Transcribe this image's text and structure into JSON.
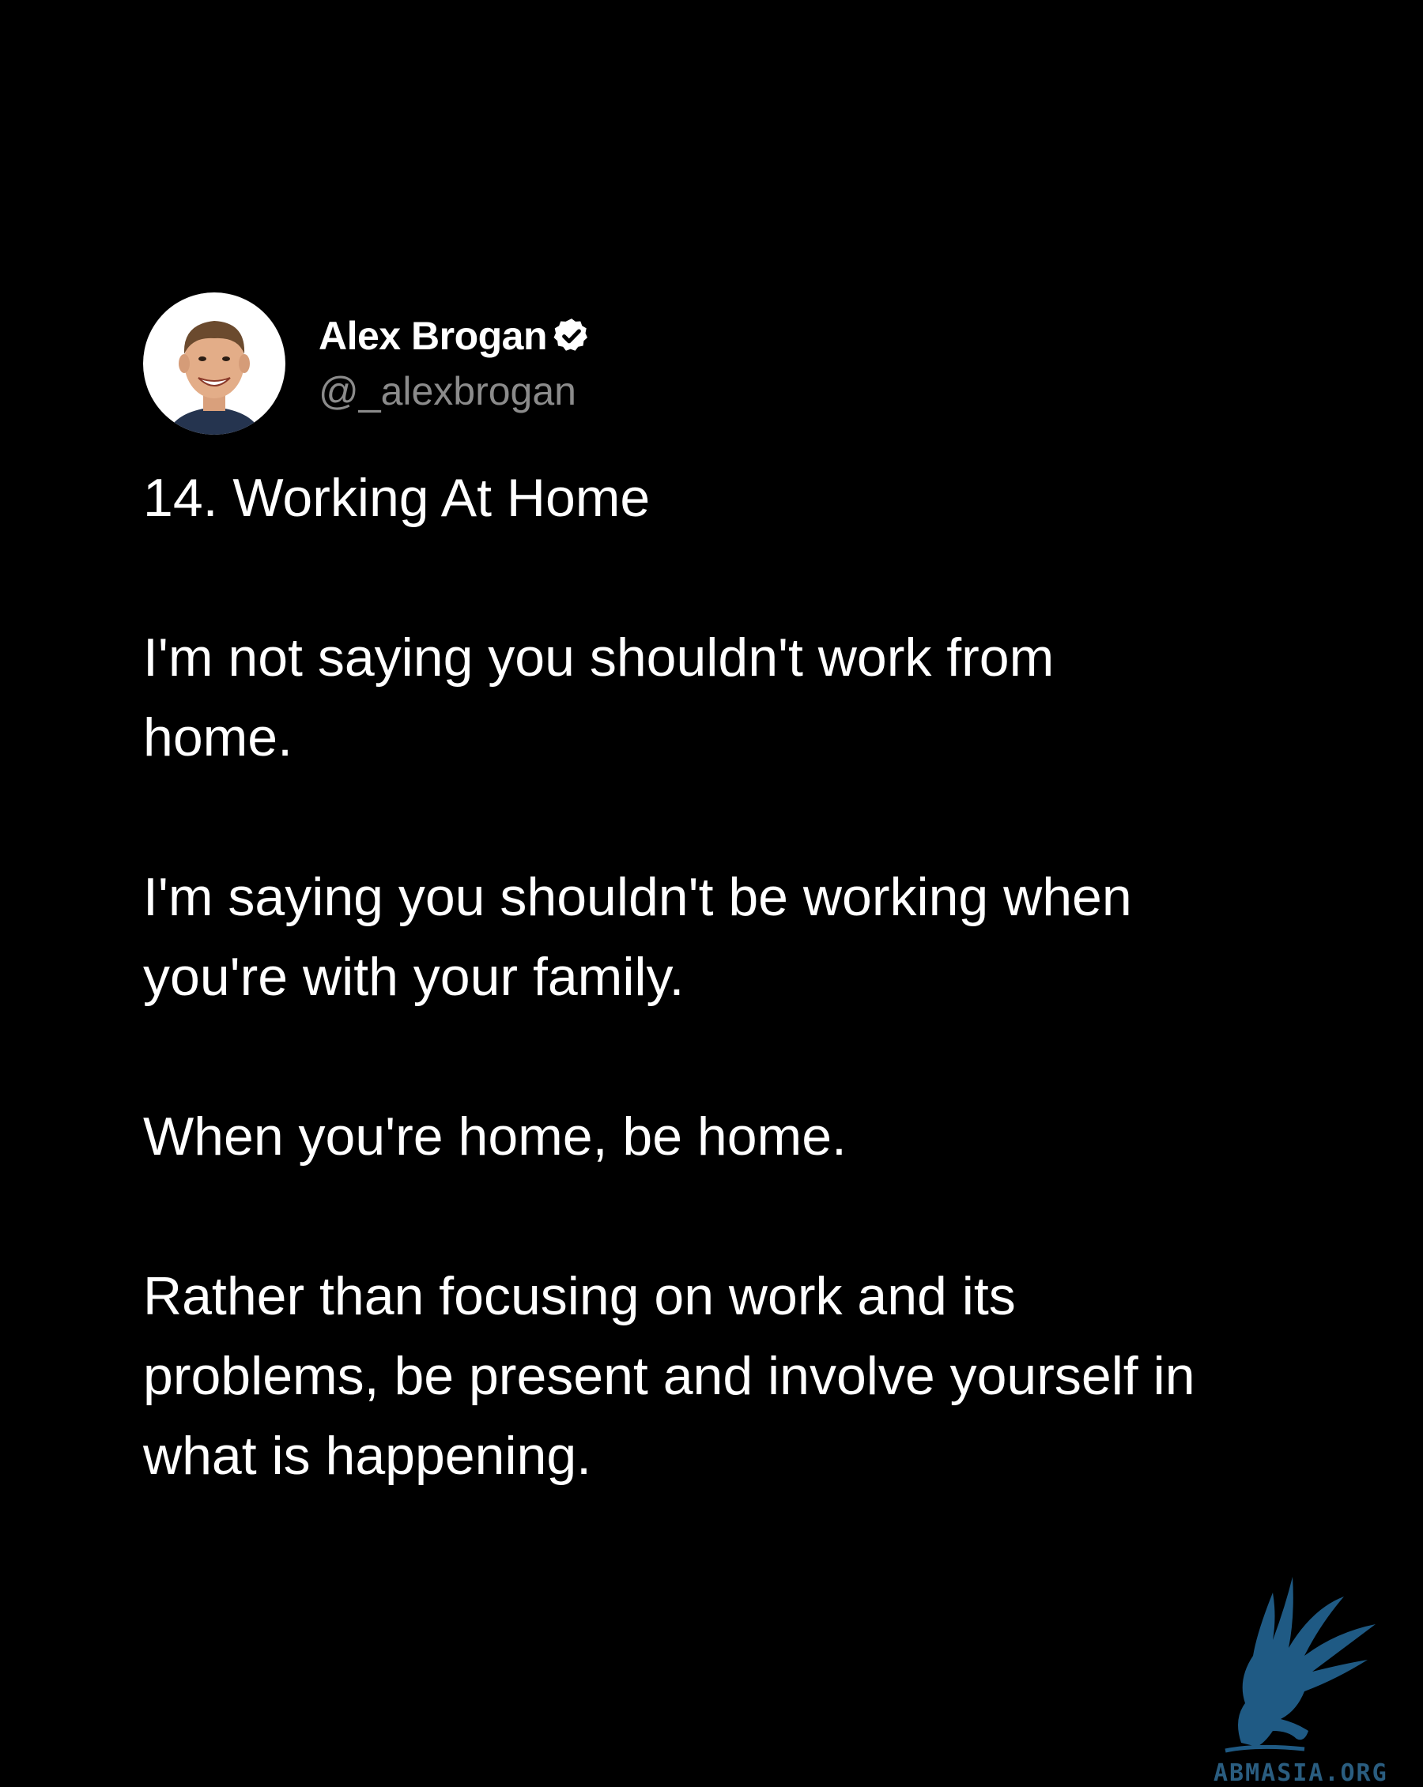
{
  "author": {
    "display_name": "Alex Brogan",
    "handle": "@_alexbrogan",
    "verified": true
  },
  "post": {
    "title": "14. Working At Home",
    "paragraphs": [
      "I'm not saying you shouldn't work from\nhome.",
      "I'm saying you shouldn't be working when\nyou're with your family.",
      "When you're home, be home.",
      "Rather than focusing on work and its\nproblems, be present and involve yourself in\nwhat is happening."
    ]
  },
  "watermark": {
    "text": "ABMASIA.ORG"
  },
  "colors": {
    "background": "#000000",
    "text": "#ffffff",
    "handle": "#8b8b8b",
    "watermark": "#1f5a84"
  }
}
